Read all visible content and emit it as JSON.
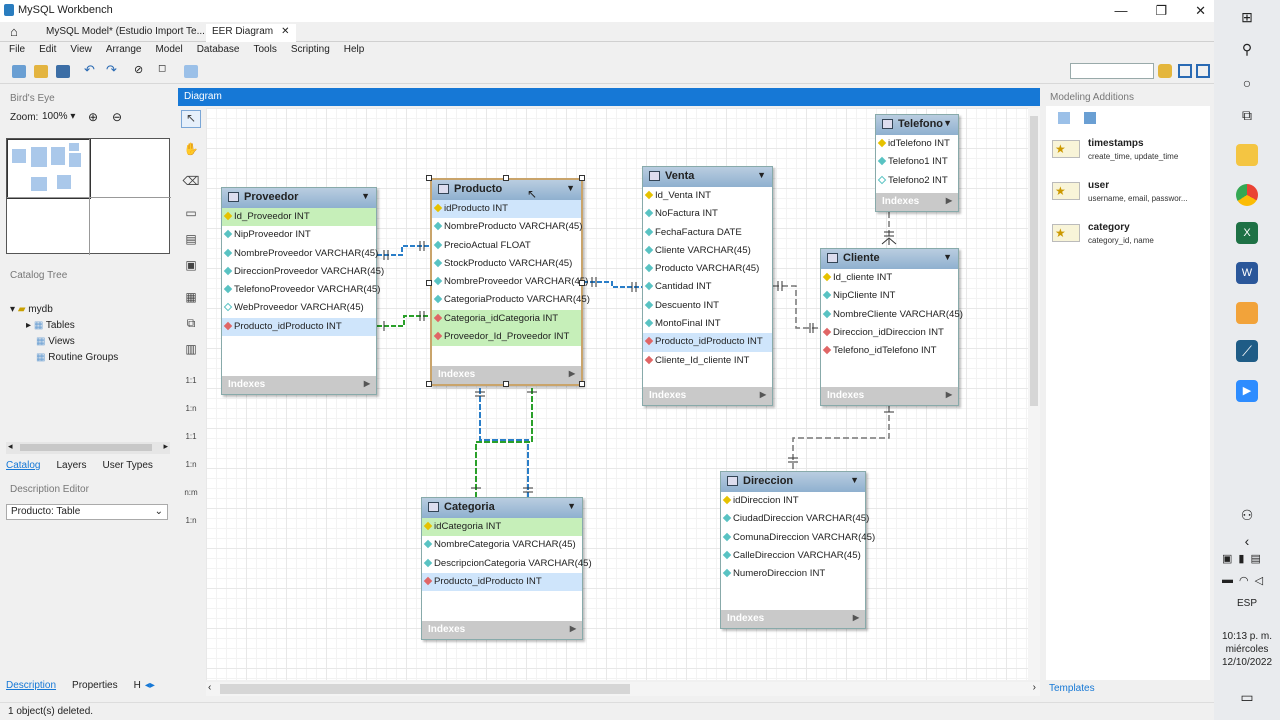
{
  "window": {
    "title": "MySQL Workbench",
    "controls": [
      "—",
      "❐",
      "✕"
    ]
  },
  "tabs": [
    {
      "label": "MySQL Model* (Estudio Import Te..."
    },
    {
      "label": "EER Diagram"
    }
  ],
  "menu": [
    "File",
    "Edit",
    "View",
    "Arrange",
    "Model",
    "Database",
    "Tools",
    "Scripting",
    "Help"
  ],
  "left": {
    "birds_eye": "Bird's Eye",
    "zoom_label": "Zoom:",
    "zoom_value": "100%",
    "catalog_tree": "Catalog Tree",
    "tree": {
      "root": "mydb",
      "tables": "Tables",
      "views": "Views",
      "routines": "Routine Groups"
    },
    "tabs": [
      "Catalog",
      "Layers",
      "User Types"
    ],
    "desc_editor": "Description Editor",
    "desc_value": "Producto: Table",
    "bottom_tabs": [
      "Description",
      "Properties",
      "H"
    ]
  },
  "diagram": {
    "header": "Diagram",
    "indexes_label": "Indexes"
  },
  "tables": {
    "proveedor": {
      "name": "Proveedor",
      "cols": [
        "Id_Proveedor INT",
        "NipProveedor INT",
        "NombreProveedor VARCHAR(45)",
        "DireccionProveedor VARCHAR(45)",
        "TelefonoProveedor VARCHAR(45)",
        "WebProveedor VARCHAR(45)",
        "Producto_idProducto INT"
      ]
    },
    "producto": {
      "name": "Producto",
      "cols": [
        "idProducto INT",
        "NombreProducto VARCHAR(45)",
        "PrecioActual FLOAT",
        "StockProducto VARCHAR(45)",
        "NombreProveedor VARCHAR(45)",
        "CategoriaProducto VARCHAR(45)",
        "Categoria_idCategoria INT",
        "Proveedor_Id_Proveedor INT"
      ]
    },
    "venta": {
      "name": "Venta",
      "cols": [
        "Id_Venta INT",
        "NoFactura INT",
        "FechaFactura DATE",
        "Cliente VARCHAR(45)",
        "Producto VARCHAR(45)",
        "Cantidad INT",
        "Descuento INT",
        "MontoFinal INT",
        "Producto_idProducto INT",
        "Cliente_Id_cliente INT"
      ]
    },
    "telefono": {
      "name": "Telefono",
      "cols": [
        "idTelefono INT",
        "Telefono1 INT",
        "Telefono2 INT"
      ]
    },
    "cliente": {
      "name": "Cliente",
      "cols": [
        "Id_cliente INT",
        "NipCliente INT",
        "NombreCliente VARCHAR(45)",
        "Direccion_idDireccion INT",
        "Telefono_idTelefono INT"
      ]
    },
    "categoria": {
      "name": "Categoria",
      "cols": [
        "idCategoria INT",
        "NombreCategoria VARCHAR(45)",
        "DescripcionCategoria VARCHAR(45)",
        "Producto_idProducto INT"
      ]
    },
    "direccion": {
      "name": "Direccion",
      "cols": [
        "idDireccion INT",
        "CiudadDireccion VARCHAR(45)",
        "ComunaDireccion VARCHAR(45)",
        "CalleDireccion VARCHAR(45)",
        "NumeroDireccion INT"
      ]
    }
  },
  "modeling": {
    "title": "Modeling Additions",
    "templates_tab": "Templates",
    "items": [
      {
        "name": "timestamps",
        "desc": "create_time, update_time"
      },
      {
        "name": "user",
        "desc": "username, email, passwor..."
      },
      {
        "name": "category",
        "desc": "category_id, name"
      }
    ]
  },
  "status": "1 object(s) deleted.",
  "tool_labels": [
    "1:1",
    "1:n",
    "1:1",
    "1:n",
    "n:m",
    "1:n"
  ],
  "taskbar": {
    "lang": "ESP",
    "time": "10:13 p. m.",
    "day": "miércoles",
    "date": "12/10/2022"
  },
  "colors": {
    "accent": "#1678d6",
    "pk_row": "#c6efb9",
    "selected_row": "#cfe5fb"
  }
}
